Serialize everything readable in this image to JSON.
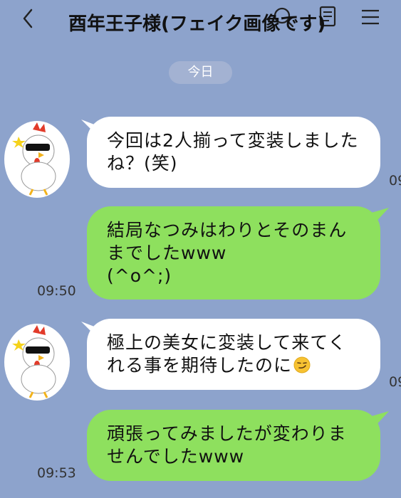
{
  "header": {
    "title": "酉年王子様(フェイク画像です)"
  },
  "date_divider": "今日",
  "messages": [
    {
      "direction": "incoming",
      "lines": [
        "今回は2人揃って変装しました",
        "ね？(笑)"
      ],
      "time": "09:"
    },
    {
      "direction": "outgoing",
      "lines": [
        "結局なつみはわりとそのまん",
        "までしたwww",
        "(^o^;)"
      ],
      "time": "09:50"
    },
    {
      "direction": "incoming",
      "lines": [
        "極上の美女に変装して来てく",
        "れる事を期待したのに"
      ],
      "emoji": "smirking-face-emoji",
      "time": "09:"
    },
    {
      "direction": "outgoing",
      "lines": [
        "頑張ってみましたが変わりま",
        "せんでしたwww"
      ],
      "time": "09:53"
    }
  ],
  "colors": {
    "background": "#8da3cc",
    "incoming_bubble": "#ffffff",
    "outgoing_bubble": "#8ee05e",
    "date_pill": "#a3b2d2"
  }
}
